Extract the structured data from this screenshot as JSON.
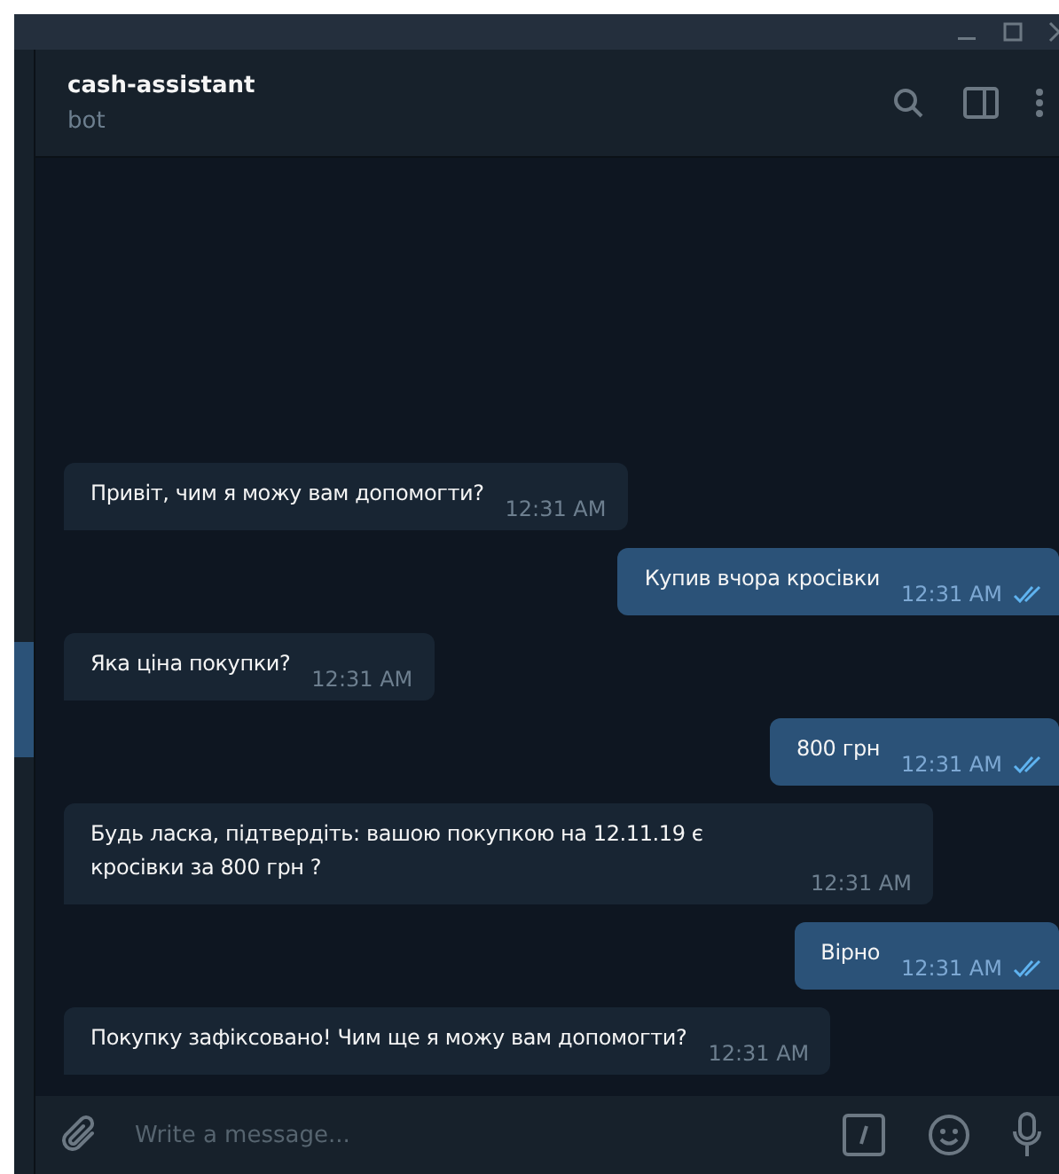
{
  "chat": {
    "title": "cash-assistant",
    "subtitle": "bot"
  },
  "messages": [
    {
      "kind": "in",
      "text": "Привіт, чим я можу вам допомогти?",
      "time": "12:31 AM"
    },
    {
      "kind": "out",
      "text": "Купив вчора кросівки",
      "time": "12:31 AM",
      "read": true
    },
    {
      "kind": "in",
      "text": "Яка ціна покупки?",
      "time": "12:31 AM"
    },
    {
      "kind": "out",
      "text": "800 грн",
      "time": "12:31 AM",
      "read": true
    },
    {
      "kind": "in",
      "text": "Будь ласка, підтвердіть: вашою покупкою на 12.11.19 є кросівки за 800 грн ?",
      "time": "12:31 AM"
    },
    {
      "kind": "out",
      "text": "Вірно",
      "time": "12:31 AM",
      "read": true
    },
    {
      "kind": "in",
      "text": "Покупку зафіксовано! Чим ще я можу вам допомогти?",
      "time": "12:31 AM"
    }
  ],
  "composer": {
    "placeholder": "Write a message..."
  }
}
